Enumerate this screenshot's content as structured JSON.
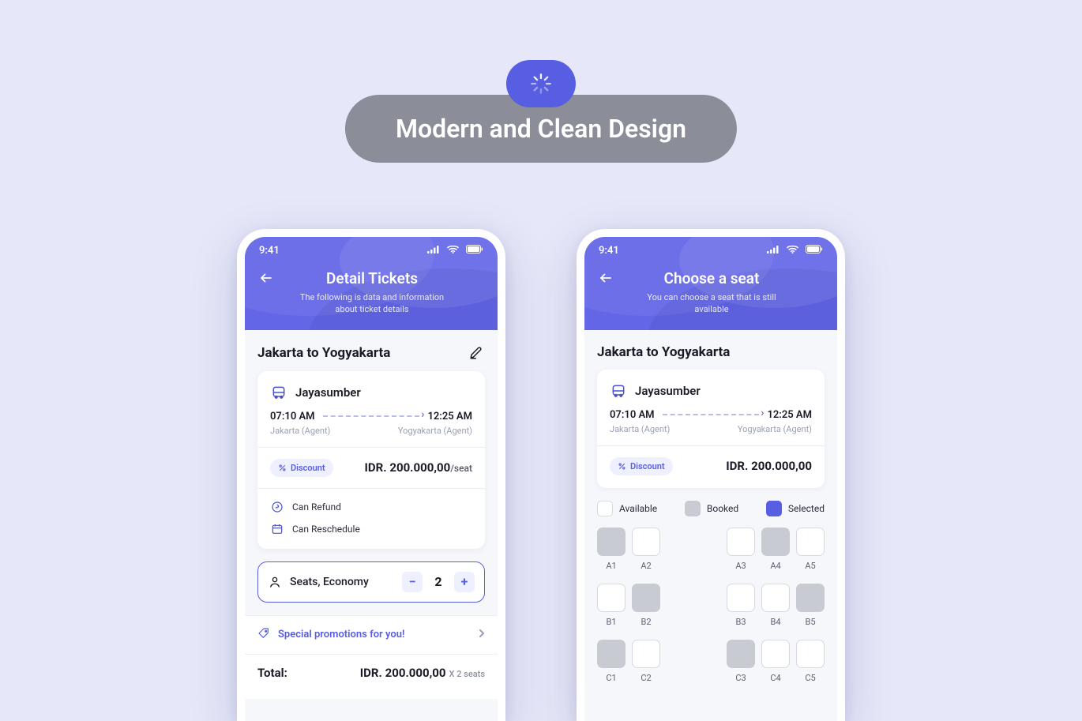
{
  "hero": {
    "title": "Modern and Clean Design",
    "icon": "spinner-icon"
  },
  "statusbar": {
    "time": "9:41"
  },
  "phone1": {
    "header": {
      "title": "Detail Tickets",
      "subtitle": "The following is data and information about ticket details"
    },
    "route": "Jakarta to Yogyakarta",
    "operator": "Jayasumber",
    "departTime": "07:10 AM",
    "arriveTime": "12:25 AM",
    "departAgent": "Jakarta (Agent)",
    "arriveAgent": "Yogyakarta (Agent)",
    "discountLabel": "Discount",
    "price": "IDR. 200.000,00",
    "priceSuffix": "/seat",
    "perks": {
      "refund": "Can Refund",
      "reschedule": "Can Reschedule"
    },
    "seats": {
      "label": "Seats, Economy",
      "value": "2"
    },
    "promo": "Special promotions for you!",
    "totalLabel": "Total:",
    "totalPrice": "IDR. 200.000,00",
    "totalMult": "X 2 seats"
  },
  "phone2": {
    "header": {
      "title": "Choose a seat",
      "subtitle": "You can choose a seat that is still available"
    },
    "route": "Jakarta to Yogyakarta",
    "operator": "Jayasumber",
    "departTime": "07:10 AM",
    "arriveTime": "12:25 AM",
    "departAgent": "Jakarta (Agent)",
    "arriveAgent": "Yogyakarta (Agent)",
    "discountLabel": "Discount",
    "price": "IDR. 200.000,00",
    "legend": {
      "available": "Available",
      "booked": "Booked",
      "selected": "Selected"
    },
    "seatRows": [
      {
        "left": [
          {
            "id": "A1",
            "state": "booked"
          },
          {
            "id": "A2",
            "state": "available"
          }
        ],
        "right": [
          {
            "id": "A3",
            "state": "available"
          },
          {
            "id": "A4",
            "state": "booked"
          },
          {
            "id": "A5",
            "state": "available"
          }
        ]
      },
      {
        "left": [
          {
            "id": "B1",
            "state": "available"
          },
          {
            "id": "B2",
            "state": "booked"
          }
        ],
        "right": [
          {
            "id": "B3",
            "state": "available"
          },
          {
            "id": "B4",
            "state": "available"
          },
          {
            "id": "B5",
            "state": "booked"
          }
        ]
      },
      {
        "left": [
          {
            "id": "C1",
            "state": "booked"
          },
          {
            "id": "C2",
            "state": "available"
          }
        ],
        "right": [
          {
            "id": "C3",
            "state": "booked"
          },
          {
            "id": "C4",
            "state": "available"
          },
          {
            "id": "C5",
            "state": "available"
          }
        ]
      }
    ]
  }
}
